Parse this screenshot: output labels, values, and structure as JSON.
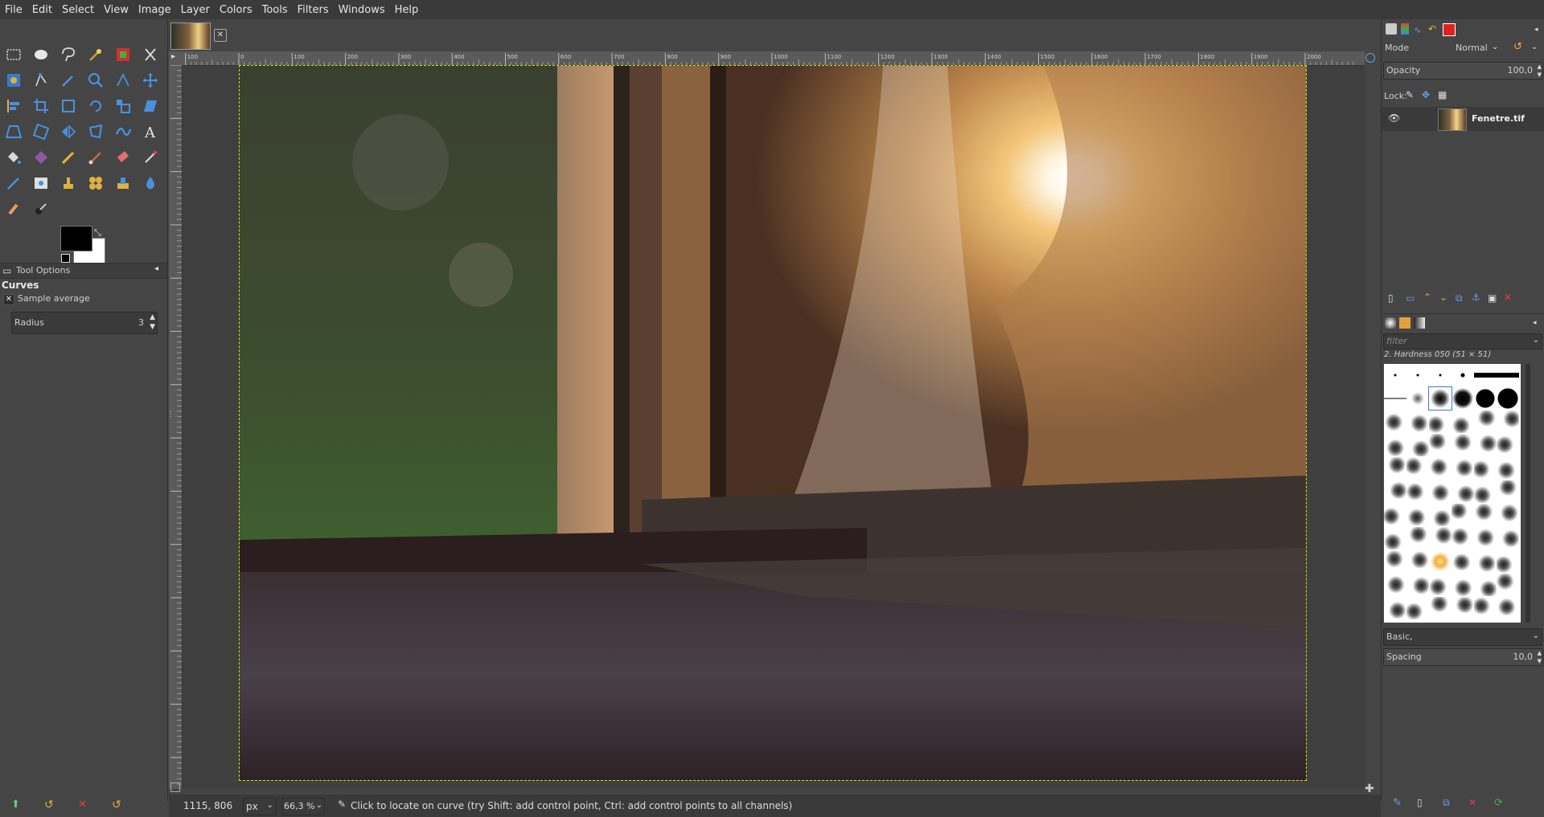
{
  "menubar": [
    "File",
    "Edit",
    "Select",
    "View",
    "Image",
    "Layer",
    "Colors",
    "Tools",
    "Filters",
    "Windows",
    "Help"
  ],
  "toolbox": {
    "tool_options_title": "Tool Options",
    "active_tool": "Curves",
    "sample_average_label": "Sample average",
    "radius_label": "Radius",
    "radius_value": "3"
  },
  "rulers": {
    "h_ticks": [
      "100",
      "0",
      "100",
      "200",
      "300",
      "400",
      "500",
      "600",
      "700",
      "800",
      "900",
      "1000",
      "1100",
      "1200",
      "1300",
      "1400",
      "1500",
      "1600",
      "1700",
      "1800",
      "1900",
      "2000"
    ]
  },
  "layers": {
    "mode_label": "Mode",
    "mode_value": "Normal",
    "opacity_label": "Opacity",
    "opacity_value": "100,0",
    "lock_label": "Lock:",
    "layer_name": "Fenetre.tif"
  },
  "brushes": {
    "filter_placeholder": "filter",
    "selected_brush": "2. Hardness 050 (51 × 51)",
    "preset": "Basic,",
    "spacing_label": "Spacing",
    "spacing_value": "10,0"
  },
  "status": {
    "coords": "1115, 806",
    "unit": "px",
    "zoom": "66,3 %",
    "message": "Click to locate on curve (try Shift: add control point, Ctrl: add control points to all channels)"
  },
  "colors": {
    "accent": "#e5b85a",
    "fg": "#000000",
    "bg": "#ffffff"
  }
}
